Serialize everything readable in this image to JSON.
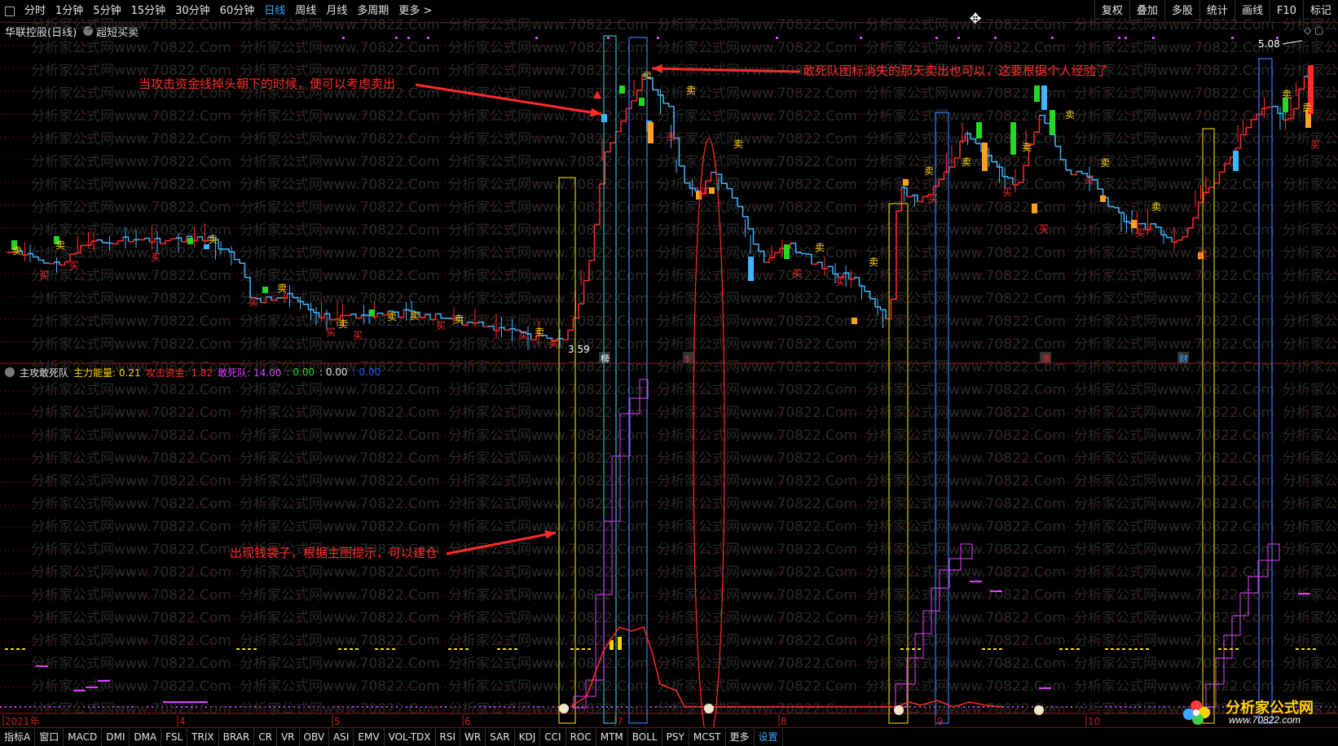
{
  "topbar": {
    "tabs": [
      "分时",
      "1分钟",
      "5分钟",
      "15分钟",
      "30分钟",
      "60分钟",
      "日线",
      "周线",
      "月线",
      "多周期",
      "更多 >"
    ],
    "active_tab": "日线",
    "right_tabs": [
      "复权",
      "叠加",
      "多股",
      "统计",
      "画线",
      "F10",
      "标记"
    ]
  },
  "stock": {
    "name": "华联控股(日线)",
    "indicator": "超短买卖"
  },
  "main_chart": {
    "high_label": "5.08",
    "low_label": "3.59",
    "markers": [
      "卖",
      "买"
    ],
    "bottom_tags": [
      "榜",
      "$",
      "涨",
      "财"
    ]
  },
  "sub_indicator": {
    "name": "主攻敢死队",
    "items": [
      {
        "label": "主力能量:",
        "value": "0.21",
        "color": "#ffd400"
      },
      {
        "label": "攻击资金:",
        "value": "1.82",
        "color": "#ff2a2a"
      },
      {
        "label": "敢死队:",
        "value": "14.00",
        "color": "#e040ff"
      },
      {
        "label": ":",
        "value": "0.00",
        "color": "#21d921"
      },
      {
        "label": ":",
        "value": "0.00",
        "color": "#e6e6e6"
      },
      {
        "label": ":",
        "value": "0.00",
        "color": "#2255ff"
      }
    ]
  },
  "date_axis": [
    "2021年",
    "4",
    "5",
    "6",
    "7",
    "8",
    "9",
    "10"
  ],
  "annotations": {
    "a1": "当攻击资金线掉头朝下的时候，便可以考虑卖出",
    "a2": "敢死队图标消失的那天卖出也可以，这要根据个人经验了",
    "a3": "出现钱袋子，根据主图提示，可以建仓"
  },
  "bottom_tabs": [
    "指标A",
    "窗口",
    "MACD",
    "DMI",
    "DMA",
    "FSL",
    "TRIX",
    "BRAR",
    "CR",
    "VR",
    "OBV",
    "ASI",
    "EMV",
    "VOL-TDX",
    "RSI",
    "WR",
    "SAR",
    "KDJ",
    "CCI",
    "ROC",
    "MTM",
    "BOLL",
    "PSY",
    "MCST",
    "更多",
    "设置"
  ],
  "watermark": "分析家公式网www.70822.Com",
  "logo": {
    "title": "分析家公式网",
    "url": "www.70822.com"
  },
  "colors": {
    "up": "#ff2a2a",
    "down": "#3fb5ff",
    "accent": "#3fa7ff",
    "yellow": "#ffd400",
    "magenta": "#e040ff"
  }
}
